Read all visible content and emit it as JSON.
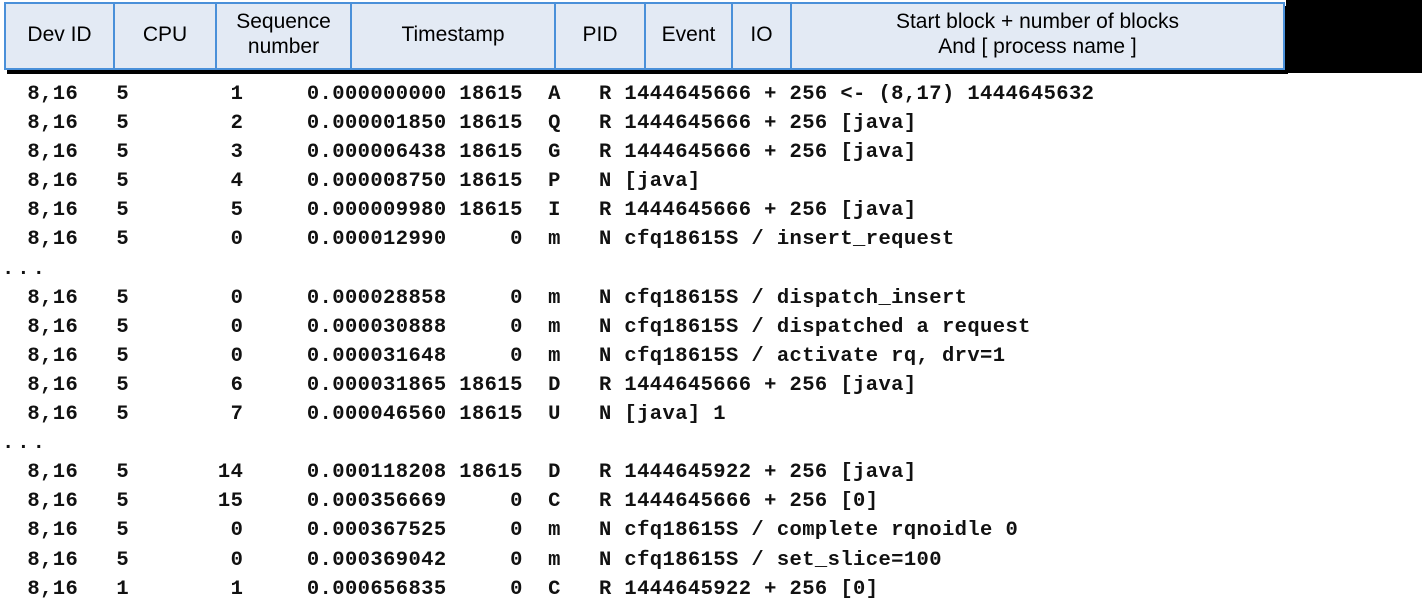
{
  "table": {
    "columns": [
      {
        "name": "dev-id",
        "label": "Dev ID"
      },
      {
        "name": "cpu",
        "label": "CPU"
      },
      {
        "name": "sequence",
        "label_line1": "Sequence",
        "label_line2": "number"
      },
      {
        "name": "timestamp",
        "label": "Timestamp"
      },
      {
        "name": "pid",
        "label": "PID"
      },
      {
        "name": "event",
        "label": "Event"
      },
      {
        "name": "io",
        "label": "IO"
      },
      {
        "name": "desc",
        "label_line1": "Start block + number  of blocks",
        "label_line2": "And [ process name ]"
      }
    ],
    "rows": [
      {
        "type": "data",
        "text": "  8,16   5        1     0.000000000 18615  A   R 1444645666 + 256 <- (8,17) 1444645632"
      },
      {
        "type": "data",
        "text": "  8,16   5        2     0.000001850 18615  Q   R 1444645666 + 256 [java]"
      },
      {
        "type": "data",
        "text": "  8,16   5        3     0.000006438 18615  G   R 1444645666 + 256 [java]"
      },
      {
        "type": "data",
        "text": "  8,16   5        4     0.000008750 18615  P   N [java]"
      },
      {
        "type": "data",
        "text": "  8,16   5        5     0.000009980 18615  I   R 1444645666 + 256 [java]"
      },
      {
        "type": "data",
        "text": "  8,16   5        0     0.000012990     0  m   N cfq18615S / insert_request"
      },
      {
        "type": "ellipsis",
        "text": "..."
      },
      {
        "type": "data",
        "text": "  8,16   5        0     0.000028858     0  m   N cfq18615S / dispatch_insert"
      },
      {
        "type": "data",
        "text": "  8,16   5        0     0.000030888     0  m   N cfq18615S / dispatched a request"
      },
      {
        "type": "data",
        "text": "  8,16   5        0     0.000031648     0  m   N cfq18615S / activate rq, drv=1"
      },
      {
        "type": "data",
        "text": "  8,16   5        6     0.000031865 18615  D   R 1444645666 + 256 [java]"
      },
      {
        "type": "data",
        "text": "  8,16   5        7     0.000046560 18615  U   N [java] 1"
      },
      {
        "type": "ellipsis",
        "text": "..."
      },
      {
        "type": "data",
        "text": "  8,16   5       14     0.000118208 18615  D   R 1444645922 + 256 [java]"
      },
      {
        "type": "data",
        "text": "  8,16   5       15     0.000356669     0  C   R 1444645666 + 256 [0]"
      },
      {
        "type": "data",
        "text": "  8,16   5        0     0.000367525     0  m   N cfq18615S / complete rqnoidle 0"
      },
      {
        "type": "data",
        "text": "  8,16   5        0     0.000369042     0  m   N cfq18615S / set_slice=100"
      },
      {
        "type": "data",
        "text": "  8,16   1        1     0.000656835     0  C   R 1444645922 + 256 [0]"
      }
    ]
  },
  "colors": {
    "header_background": "#e3eaf4",
    "header_border": "#4a90d9",
    "shadow": "#000000",
    "text": "#111111",
    "page_background": "#ffffff"
  }
}
